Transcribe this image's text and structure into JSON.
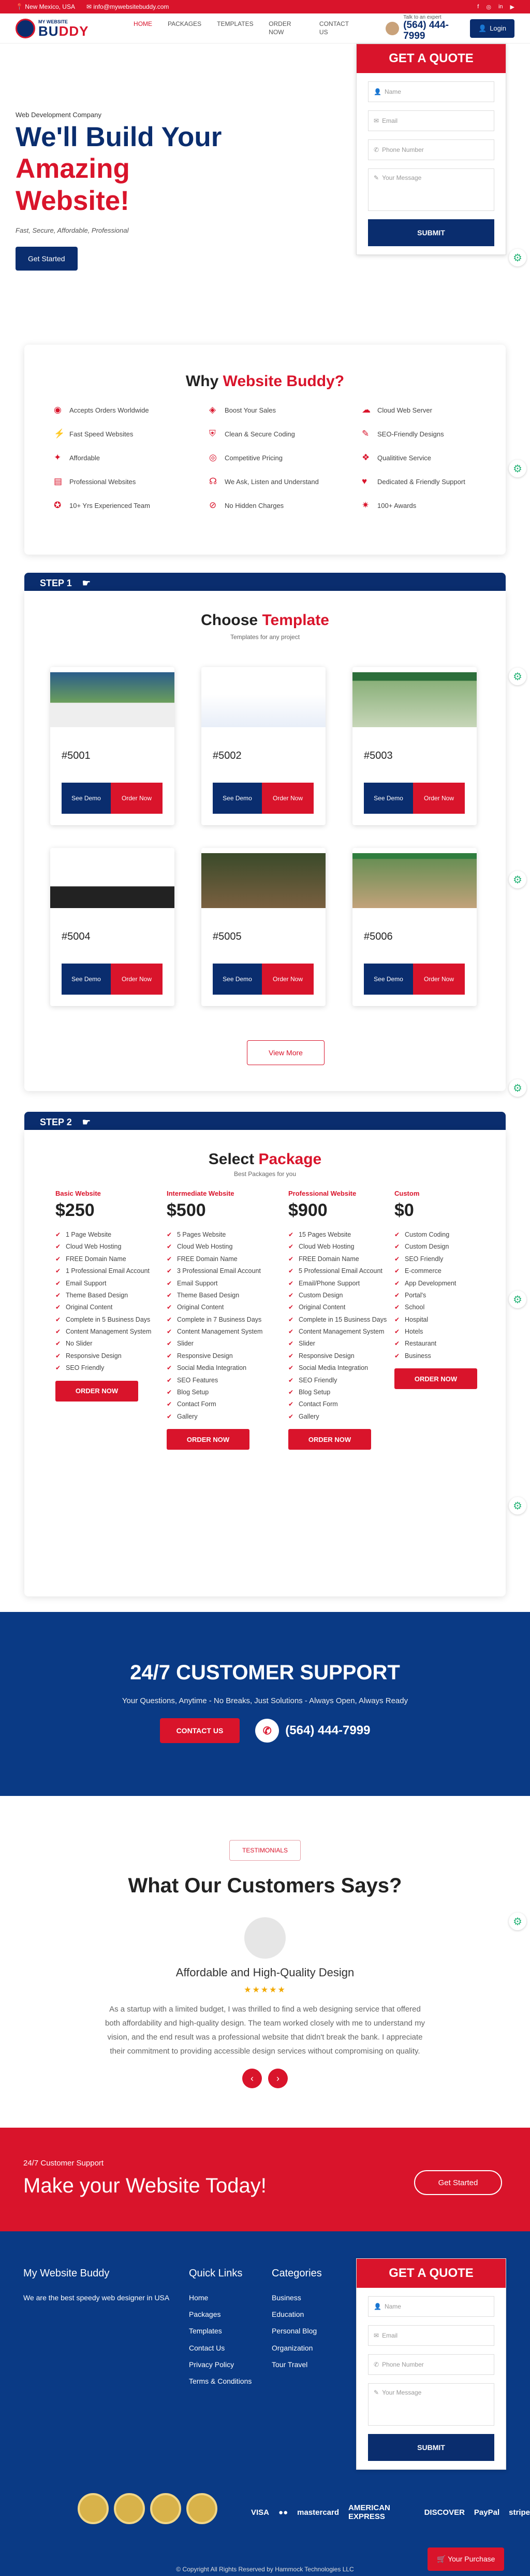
{
  "topbar": {
    "location": "New Mexico, USA",
    "email": "info@mywebsitebuddy.com",
    "social": [
      "f",
      "◎",
      "in",
      "▶"
    ]
  },
  "logo": {
    "small": "MY WEBSITE",
    "big1": "BU",
    "big2": "DDY"
  },
  "nav": [
    "HOME",
    "PACKAGES",
    "TEMPLATES",
    "ORDER NOW",
    "CONTACT US"
  ],
  "talk": {
    "label": "Talk to an expert",
    "phone": "(564) 444-7999"
  },
  "login": "Login",
  "hero": {
    "kicker": "Web Development Company",
    "l1": "We'll Build Your",
    "l2": "Amazing",
    "l3": "Website!",
    "sub": "Fast, Secure, Affordable, Professional",
    "btn": "Get Started"
  },
  "quote": {
    "title": "GET A QUOTE",
    "name": "Name",
    "email": "Email",
    "phone": "Phone Number",
    "message": "Your Message",
    "submit": "SUBMIT"
  },
  "why": {
    "t1": "Why ",
    "t2": "Website Buddy?",
    "features": [
      "Accepts Orders Worldwide",
      "Boost Your Sales",
      "Cloud Web Server",
      "Fast Speed Websites",
      "Clean & Secure Coding",
      "SEO-Friendly Designs",
      "Affordable",
      "Competitive Pricing",
      "Qualititive Service",
      "Professional Websites",
      "We Ask, Listen and Understand",
      "Dedicated & Friendly Support",
      "10+ Yrs Experienced Team",
      "No Hidden Charges",
      "100+ Awards"
    ]
  },
  "step1": {
    "label": "STEP 1",
    "t1": "Choose ",
    "t2": "Template",
    "sub": "Templates for any project",
    "templates": [
      "#5001",
      "#5002",
      "#5003",
      "#5004",
      "#5005",
      "#5006"
    ],
    "demo": "See Demo",
    "order": "Order Now",
    "more": "View More"
  },
  "step2": {
    "label": "STEP 2",
    "t1": "Select ",
    "t2": "Package",
    "sub": "Best Packages for you",
    "order": "ORDER NOW",
    "packages": [
      {
        "name": "Basic Website",
        "price": "$250",
        "items": [
          "1 Page Website",
          "Cloud Web Hosting",
          "FREE Domain Name",
          "1 Professional Email Account",
          "Email Support",
          "Theme Based Design",
          "Original Content",
          "Complete in 5 Business Days",
          "Content Management System",
          "No Slider",
          "Responsive Design",
          "SEO Friendly"
        ]
      },
      {
        "name": "Intermediate Website",
        "price": "$500",
        "items": [
          "5 Pages Website",
          "Cloud Web Hosting",
          "FREE Domain Name",
          "3 Professional Email Account",
          "Email Support",
          "Theme Based Design",
          "Original Content",
          "Complete in 7 Business Days",
          "Content Management System",
          "Slider",
          "Responsive Design",
          "Social Media Integration",
          "SEO Features",
          "Blog Setup",
          "Contact Form",
          "Gallery"
        ]
      },
      {
        "name": "Professional Website",
        "price": "$900",
        "items": [
          "15 Pages Website",
          "Cloud Web Hosting",
          "FREE Domain Name",
          "5 Professional Email Account",
          "Email/Phone Support",
          "Custom Design",
          "Original Content",
          "Complete in 15 Business Days",
          "Content Management System",
          "Slider",
          "Responsive Design",
          "Social Media Integration",
          "SEO Friendly",
          "Blog Setup",
          "Contact Form",
          "Gallery"
        ]
      },
      {
        "name": "Custom",
        "price": "$0",
        "items": [
          "Custom Coding",
          "Custom Design",
          "SEO Friendly",
          "E-commerce",
          "App Development",
          "Portal's",
          "School",
          "Hospital",
          "Hotels",
          "Restaurant",
          "Business"
        ]
      }
    ]
  },
  "support": {
    "title": "24/7 CUSTOMER SUPPORT",
    "text": "Your Questions, Anytime - No Breaks, Just Solutions - Always Open, Always Ready",
    "btn": "CONTACT US",
    "phone": "(564) 444-7999"
  },
  "testimonials": {
    "tag": "TESTIMONIALS",
    "title": "What Our Customers Says?",
    "head": "Affordable and High-Quality Design",
    "stars": "★★★★★",
    "body": "As a startup with a limited budget, I was thrilled to find a web designing service that offered both affordability and high-quality design. The team worked closely with me to understand my vision, and the end result was a professional website that didn't break the bank. I appreciate their commitment to providing accessible design services without compromising on quality."
  },
  "cta": {
    "small": "24/7 Customer Support",
    "title": "Make your Website Today!",
    "btn": "Get Started"
  },
  "footer": {
    "about_title": "My Website Buddy",
    "about": "We are the best speedy web designer in USA",
    "quick_title": "Quick Links",
    "quick": [
      "Home",
      "Packages",
      "Templates",
      "Contact Us",
      "Privacy Policy",
      "Terms & Conditions"
    ],
    "cat_title": "Categories",
    "cats": [
      "Business",
      "Education",
      "Personal Blog",
      "Organization",
      "Tour Travel"
    ],
    "payments": [
      "VISA",
      "●●",
      "mastercard",
      "AMERICAN EXPRESS",
      "DISCOVER",
      "PayPal",
      "stripe"
    ],
    "copy": "© Copyright All Rights Reserved by Hammock Technologies LLC",
    "purchase": "Your Purchase"
  }
}
